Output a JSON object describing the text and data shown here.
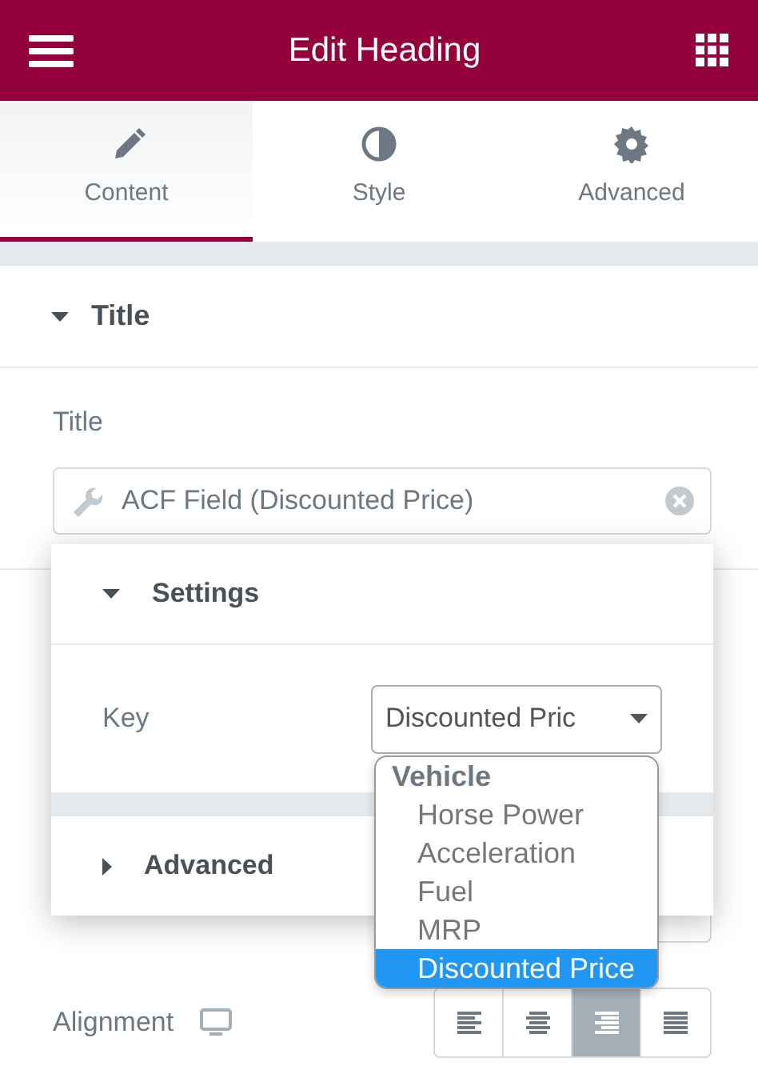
{
  "header": {
    "title": "Edit Heading"
  },
  "tabs": [
    {
      "label": "Content",
      "selected": true
    },
    {
      "label": "Style",
      "selected": false
    },
    {
      "label": "Advanced",
      "selected": false
    }
  ],
  "section": {
    "title": "Title",
    "expanded": true
  },
  "title_field": {
    "label": "Title",
    "value": "ACF Field (Discounted Price)"
  },
  "dynamic_popup": {
    "sections": [
      {
        "title": "Settings",
        "expanded": true
      },
      {
        "title": "Advanced",
        "expanded": false
      }
    ],
    "key": {
      "label": "Key",
      "value": "Discounted Pric"
    }
  },
  "dropdown": {
    "groups": [
      {
        "label": "Vehicle",
        "options": [
          {
            "label": "Horse Power",
            "selected": false
          },
          {
            "label": "Acceleration",
            "selected": false
          },
          {
            "label": "Fuel",
            "selected": false
          },
          {
            "label": "MRP",
            "selected": false
          },
          {
            "label": "Discounted Price",
            "selected": true
          }
        ]
      }
    ]
  },
  "alignment": {
    "label": "Alignment",
    "options": [
      {
        "kind": "left",
        "selected": false
      },
      {
        "kind": "center",
        "selected": false
      },
      {
        "kind": "right",
        "selected": true
      },
      {
        "kind": "justify",
        "selected": false
      }
    ]
  }
}
